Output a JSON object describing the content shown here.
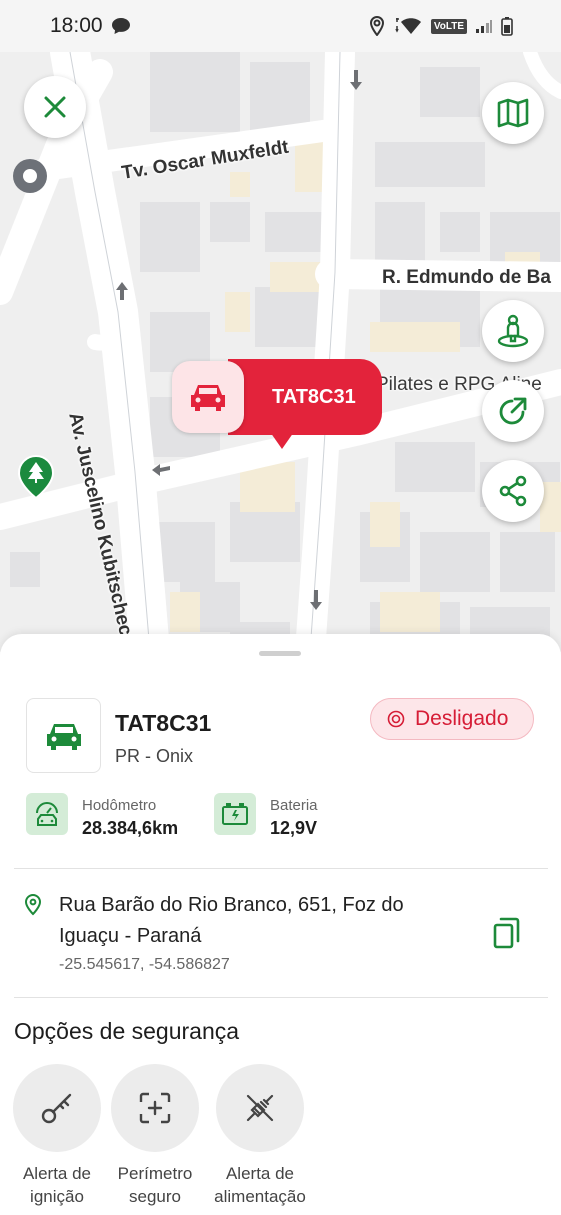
{
  "status_bar": {
    "time": "18:00",
    "network_chip": "VoLTE"
  },
  "map": {
    "streets": {
      "oscar": "Tv. Oscar Muxfeldt",
      "edmundo": "R. Edmundo de Ba",
      "pilates": "Pilates e RPG Aline",
      "juscelino": "Av. Juscelino Kubitschec"
    },
    "marker": {
      "plate": "TAT8C31"
    },
    "buttons": [
      "close-icon",
      "map-layers-icon",
      "street-view-icon",
      "share-external-icon",
      "share-icon"
    ]
  },
  "vehicle": {
    "plate": "TAT8C31",
    "model": "PR - Onix",
    "status": "Desligado",
    "status_color": "#d61d36"
  },
  "stats": {
    "odometer": {
      "label": "Hodômetro",
      "value": "28.384,6km"
    },
    "battery": {
      "label": "Bateria",
      "value": "12,9V"
    }
  },
  "address": {
    "text": "Rua Barão do Rio Branco, 651, Foz do Iguaçu - Paraná",
    "coords": "-25.545617, -54.586827"
  },
  "security": {
    "title": "Opções de segurança",
    "options": [
      {
        "label": "Alerta de\nignição",
        "icon": "key-icon"
      },
      {
        "label": "Perímetro\nseguro",
        "icon": "perimeter-icon"
      },
      {
        "label": "Alerta de\nalimentação",
        "icon": "unplugged-icon"
      }
    ]
  },
  "colors": {
    "accent_green": "#1d8a3a",
    "marker_red": "#e3233b"
  }
}
